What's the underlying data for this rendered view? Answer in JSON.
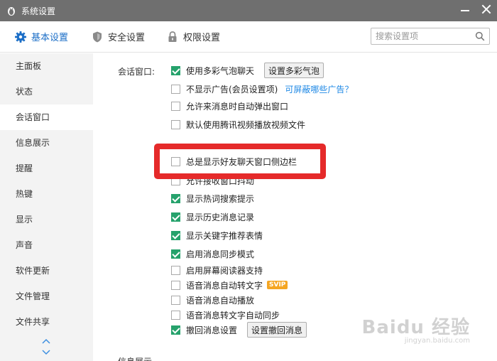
{
  "window": {
    "title": "系统设置"
  },
  "tabs": [
    {
      "label": "基本设置",
      "icon": "gear-icon"
    },
    {
      "label": "安全设置",
      "icon": "shield-icon"
    },
    {
      "label": "权限设置",
      "icon": "lock-icon"
    }
  ],
  "search": {
    "placeholder": "搜索设置项"
  },
  "sidebar": {
    "items": [
      {
        "label": "主面板"
      },
      {
        "label": "状态"
      },
      {
        "label": "会话窗口"
      },
      {
        "label": "信息展示"
      },
      {
        "label": "提醒"
      },
      {
        "label": "热键"
      },
      {
        "label": "显示"
      },
      {
        "label": "声音"
      },
      {
        "label": "软件更新"
      },
      {
        "label": "文件管理"
      },
      {
        "label": "文件共享"
      }
    ],
    "active_index": 2
  },
  "content": {
    "section_label": "会话窗口:",
    "section2_label": "信息展示",
    "options": [
      {
        "label": "使用多彩气泡聊天",
        "checked": true,
        "button": "设置多彩气泡"
      },
      {
        "label": "不显示广告(会员设置项)",
        "checked": false,
        "link": "可屏蔽哪些广告？"
      },
      {
        "label": "允许来消息时自动弹出窗口",
        "checked": false
      },
      {
        "label": "默认使用腾讯视频播放视频文件",
        "checked": false
      },
      {
        "label": "允许接收窗口抖动",
        "checked": false
      },
      {
        "label": "显示热词搜索提示",
        "checked": true
      },
      {
        "label": "显示历史消息记录",
        "checked": true
      },
      {
        "label": "显示关键字推荐表情",
        "checked": true
      },
      {
        "label": "启用消息同步模式",
        "checked": true
      },
      {
        "label": "启用屏幕阅读器支持",
        "checked": false
      },
      {
        "label": "语音消息自动转文字",
        "checked": false,
        "badge": "SVIP"
      },
      {
        "label": "语音消息自动播放",
        "checked": false
      },
      {
        "label": "语音消息转文字自动同步",
        "checked": false
      },
      {
        "label": "撤回消息设置",
        "checked": true,
        "button": "设置撤回消息"
      }
    ],
    "highlighted_option": {
      "label": "总是显示好友聊天窗口侧边栏",
      "checked": false
    }
  },
  "watermark": {
    "text": "Baidu 经验",
    "sub": "jingyan.baidu.com"
  },
  "colors": {
    "accent": "#1d6fc7",
    "check_green": "#26a26c",
    "highlight_red": "#e52a2a",
    "titlebar": "#6f6f6f"
  }
}
